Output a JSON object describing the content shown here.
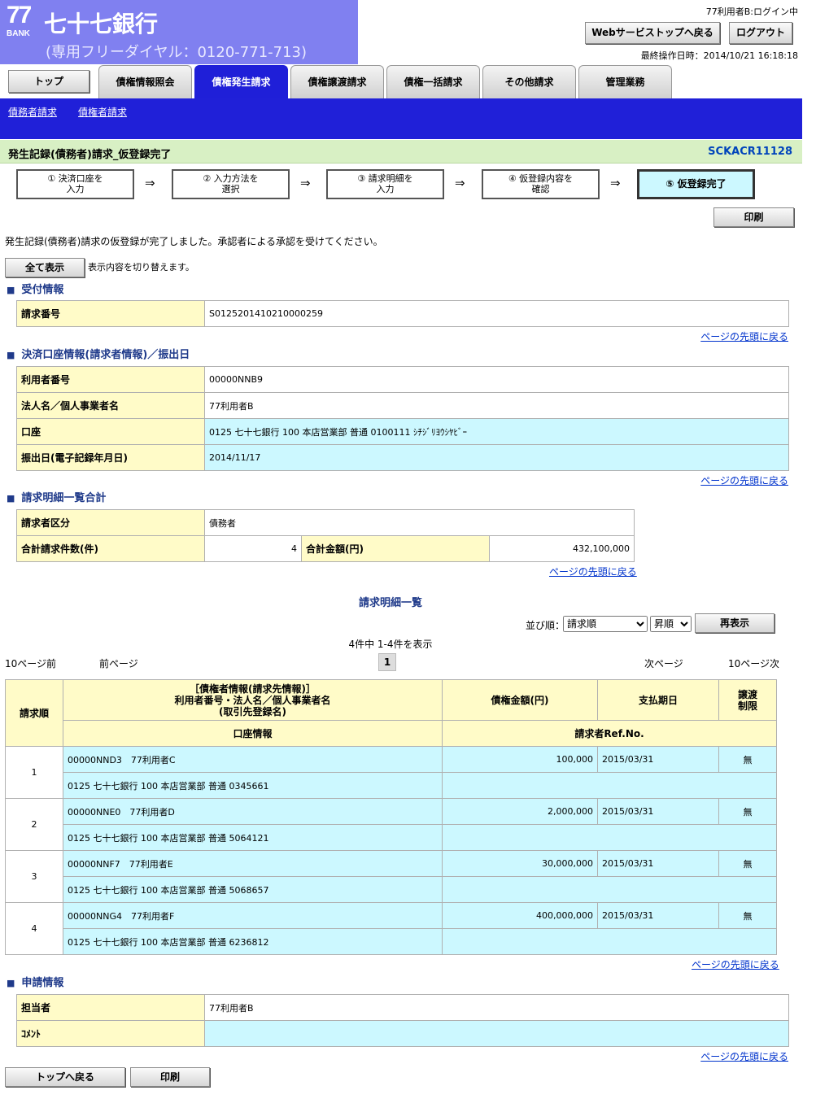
{
  "header": {
    "logo_number": "77",
    "logo_sub": "BANK",
    "bank_name": "七十七銀行",
    "dial": "(専用フリーダイヤル：0120-771-713)",
    "user_status": "77利用者B:ログイン中",
    "webtop_button": "Webサービストップへ戻る",
    "logout_button": "ログアウト",
    "last_operation": "最終操作日時：2014/10/21 16:18:18"
  },
  "tabs": {
    "top": "トップ",
    "items": [
      "債権情報照会",
      "債権発生請求",
      "債権譲渡請求",
      "債権一括請求",
      "その他請求",
      "管理業務"
    ],
    "active_index": 1
  },
  "subnav": [
    "債務者請求",
    "債権者請求"
  ],
  "title": {
    "text": "発生記録(債務者)請求_仮登録完了",
    "code": "SCKACR11128"
  },
  "steps": [
    "① 決済口座を\n入力",
    "② 入力方法を\n選択",
    "③ 請求明細を\n入力",
    "④ 仮登録内容を\n確認",
    "⑤ 仮登録完了"
  ],
  "arrow": "⇒",
  "print_button": "印刷",
  "message": "発生記録(債務者)請求の仮登録が完了しました。承認者による承認を受けてください。",
  "show_all_button": "全て表示",
  "toggle_text": "表示内容を切り替えます。",
  "page_top_link": "ページの先頭に戻る",
  "reception": {
    "heading": "受付情報",
    "label": "請求番号",
    "value": "S0125201410210000259"
  },
  "account": {
    "heading": "決済口座情報(請求者情報)／振出日",
    "rows": [
      {
        "label": "利用者番号",
        "value": "00000NNB9"
      },
      {
        "label": "法人名／個人事業者名",
        "value": "77利用者B"
      },
      {
        "label": "口座",
        "value": "0125 七十七銀行 100 本店営業部 普通 0100111 ｼﾁｼﾞﾘﾖｳｼﾔﾋﾞｰ"
      },
      {
        "label": "振出日(電子記録年月日)",
        "value": "2014/11/17"
      }
    ]
  },
  "summary": {
    "heading": "請求明細一覧合計",
    "requester_label": "請求者区分",
    "requester_value": "債務者",
    "count_label": "合計請求件数(件)",
    "count_value": "4",
    "amount_label": "合計金額(円)",
    "amount_value": "432,100,000"
  },
  "list": {
    "heading": "請求明細一覧",
    "sort_label": "並び順：",
    "sort_value": "請求順",
    "order_value": "昇順",
    "redisplay_button": "再表示",
    "count_text": "4件中 1-4件を表示",
    "prev10": "10ページ前",
    "prev": "前ページ",
    "page": "1",
    "next": "次ページ",
    "next10": "10ページ次",
    "headers": {
      "no": "請求順",
      "creditor": "［債権者情報(請求先情報)］\n利用者番号・法人名／個人事業者名\n(取引先登録名)",
      "amount": "債権金額(円)",
      "due": "支払期日",
      "restriction": "譲渡\n制限",
      "account": "口座情報",
      "ref": "請求者Ref.No."
    },
    "rows": [
      {
        "no": "1",
        "creditor": "00000NND3　77利用者C",
        "amount": "100,000",
        "due": "2015/03/31",
        "restriction": "無",
        "account": "0125 七十七銀行 100 本店営業部 普通 0345661",
        "ref": ""
      },
      {
        "no": "2",
        "creditor": "00000NNE0　77利用者D",
        "amount": "2,000,000",
        "due": "2015/03/31",
        "restriction": "無",
        "account": "0125 七十七銀行 100 本店営業部 普通 5064121",
        "ref": ""
      },
      {
        "no": "3",
        "creditor": "00000NNF7　77利用者E",
        "amount": "30,000,000",
        "due": "2015/03/31",
        "restriction": "無",
        "account": "0125 七十七銀行 100 本店営業部 普通 5068657",
        "ref": ""
      },
      {
        "no": "4",
        "creditor": "00000NNG4　77利用者F",
        "amount": "400,000,000",
        "due": "2015/03/31",
        "restriction": "無",
        "account": "0125 七十七銀行 100 本店営業部 普通 6236812",
        "ref": ""
      }
    ]
  },
  "application": {
    "heading": "申請情報",
    "person_label": "担当者",
    "person_value": "77利用者B",
    "comment_label": "ｺﾒﾝﾄ",
    "comment_value": ""
  },
  "footer": {
    "back_button": "トップへ戻る",
    "print_button": "印刷"
  }
}
